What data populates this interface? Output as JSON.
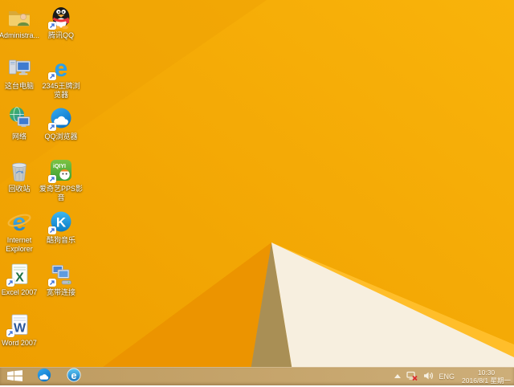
{
  "wallpaper": {
    "colors": {
      "base_left": "#EE9E00",
      "base_right": "#F9B30A",
      "upper_left_facet": "#EDA004",
      "shadow_wedge": "#EC9400",
      "tan_facet": "#A98F55",
      "white_facet": "#F7EFDF",
      "edge_highlight": "#FFBE2A"
    }
  },
  "desktop": {
    "icons": [
      {
        "name": "administrator-files",
        "label": "Administra..."
      },
      {
        "name": "tencent-qq",
        "label": "腾讯QQ"
      },
      {
        "name": "this-pc",
        "label": "这台电脑"
      },
      {
        "name": "2345-browser",
        "label": "2345王牌浏览器"
      },
      {
        "name": "network",
        "label": "网络"
      },
      {
        "name": "qq-browser",
        "label": "QQ浏览器"
      },
      {
        "name": "recycle-bin",
        "label": "回收站"
      },
      {
        "name": "iqiyi-pps",
        "label": "爱奇艺PPS影音"
      },
      {
        "name": "internet-explorer",
        "label": "Internet Explorer"
      },
      {
        "name": "kugou-music",
        "label": "酷狗音乐"
      },
      {
        "name": "excel-2007",
        "label": "Excel 2007"
      },
      {
        "name": "broadband-connection",
        "label": "宽带连接"
      },
      {
        "name": "word-2007",
        "label": "Word 2007"
      }
    ],
    "icon_glyphs": {
      "ie": "e",
      "e2345": "e",
      "kugou": "K",
      "excel": "X",
      "word": "W",
      "iqiyi": "iQIYI"
    }
  },
  "taskbar": {
    "ie_glyph": "e",
    "tray": {
      "language": "ENG",
      "time": "10:30",
      "date": "2016/8/1 星期一"
    },
    "colors": {
      "bar": "#C2A167",
      "network_error": "#DD2A2E"
    }
  }
}
